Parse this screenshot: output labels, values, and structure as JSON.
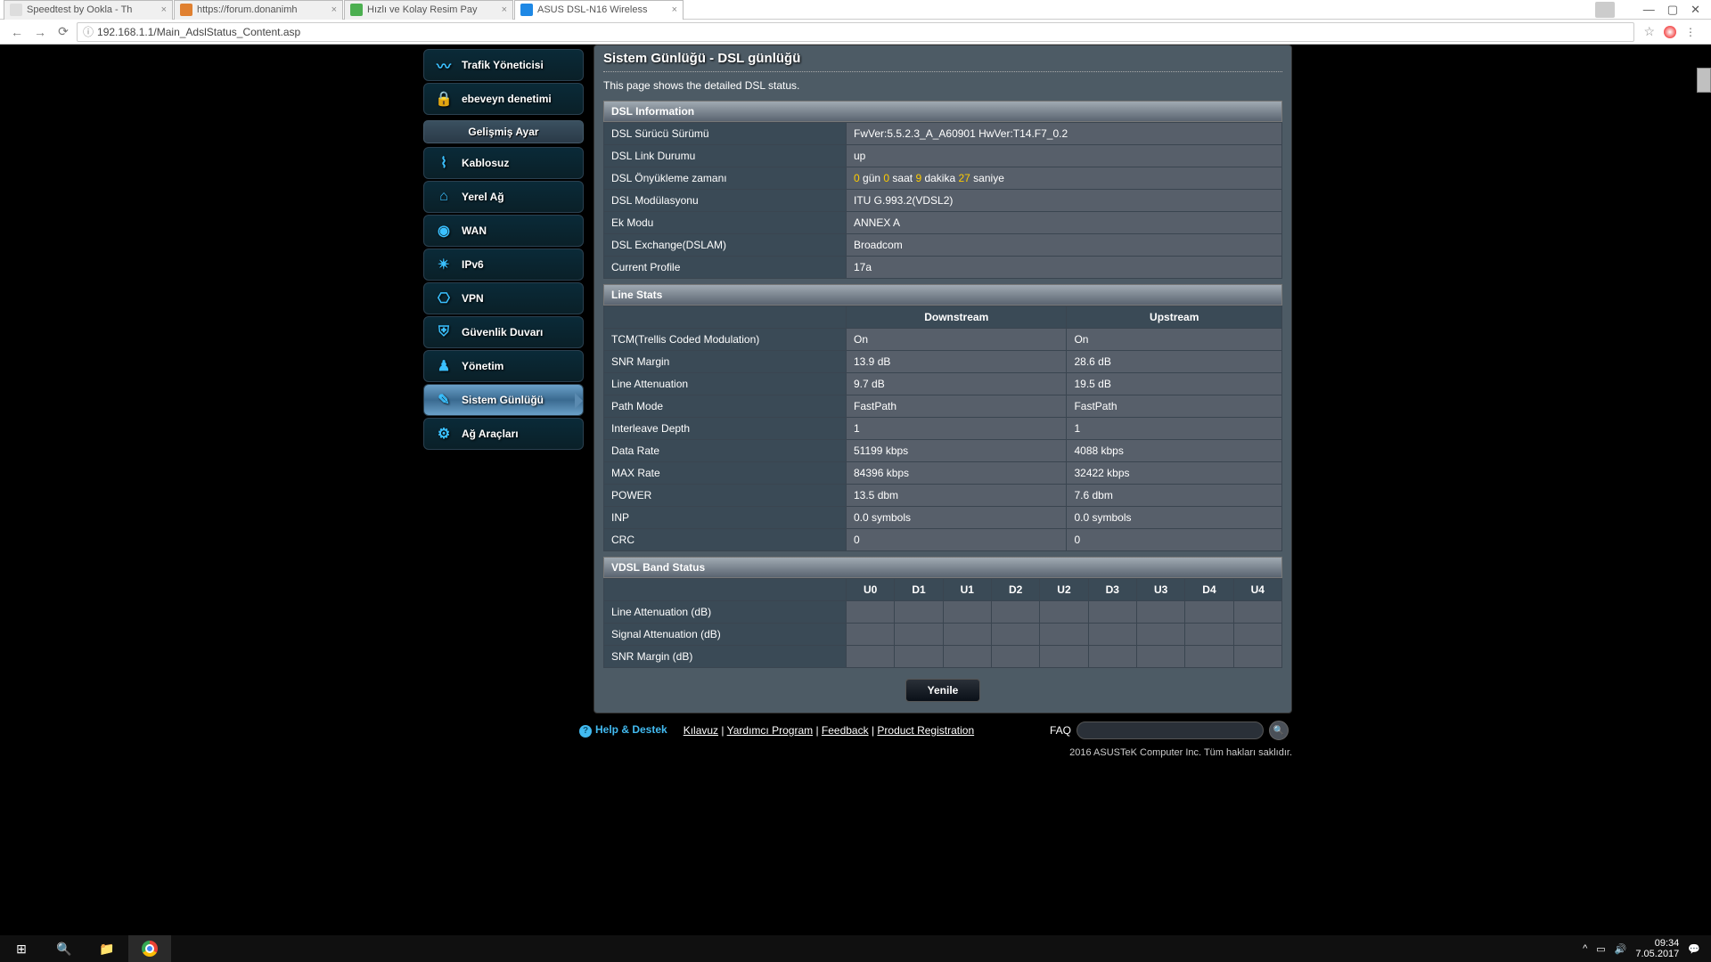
{
  "browser": {
    "tabs": [
      {
        "label": "Speedtest by Ookla - Th"
      },
      {
        "label": "https://forum.donanimh"
      },
      {
        "label": "Hızlı ve Kolay Resim Pay"
      },
      {
        "label": "ASUS DSL-N16 Wireless"
      }
    ],
    "url": "192.168.1.1/Main_AdslStatus_Content.asp"
  },
  "sidebar": {
    "items_top": [
      {
        "label": "Trafik Yöneticisi",
        "icon": "〰"
      },
      {
        "label": "ebeveyn denetimi",
        "icon": "🔒"
      }
    ],
    "section": "Gelişmiş Ayar",
    "items": [
      {
        "label": "Kablosuz",
        "icon": "⌇"
      },
      {
        "label": "Yerel Ağ",
        "icon": "⌂"
      },
      {
        "label": "WAN",
        "icon": "◉"
      },
      {
        "label": "IPv6",
        "icon": "✴"
      },
      {
        "label": "VPN",
        "icon": "⎔"
      },
      {
        "label": "Güvenlik Duvarı",
        "icon": "⛨"
      },
      {
        "label": "Yönetim",
        "icon": "♟"
      },
      {
        "label": "Sistem Günlüğü",
        "icon": "✎"
      },
      {
        "label": "Ağ Araçları",
        "icon": "⚙"
      }
    ],
    "active_index": 7
  },
  "page": {
    "title": "Sistem Günlüğü - DSL günlüğü",
    "desc": "This page shows the detailed DSL status.",
    "dsl_info_header": "DSL Information",
    "dsl_info": [
      {
        "label": "DSL Sürücü Sürümü",
        "value": "FwVer:5.5.2.3_A_A60901 HwVer:T14.F7_0.2"
      },
      {
        "label": "DSL Link Durumu",
        "value": "up"
      },
      {
        "label": "DSL Önyükleme zamanı",
        "value_parts": [
          "0",
          " gün ",
          "0",
          " saat ",
          "9",
          " dakika ",
          "27",
          " saniye"
        ]
      },
      {
        "label": "DSL Modülasyonu",
        "value": "ITU G.993.2(VDSL2)"
      },
      {
        "label": "Ek Modu",
        "value": "ANNEX A"
      },
      {
        "label": "DSL Exchange(DSLAM)",
        "value": "Broadcom"
      },
      {
        "label": "Current Profile",
        "value": "17a"
      }
    ],
    "line_stats_header": "Line Stats",
    "line_stats_cols": [
      "Downstream",
      "Upstream"
    ],
    "line_stats": [
      {
        "label": "TCM(Trellis Coded Modulation)",
        "down": "On",
        "up": "On"
      },
      {
        "label": "SNR Margin",
        "down": "13.9 dB",
        "up": "28.6 dB"
      },
      {
        "label": "Line Attenuation",
        "down": "9.7 dB",
        "up": "19.5 dB"
      },
      {
        "label": "Path Mode",
        "down": "FastPath",
        "up": "FastPath"
      },
      {
        "label": "Interleave Depth",
        "down": "1",
        "up": "1"
      },
      {
        "label": "Data Rate",
        "down": "51199 kbps",
        "up": "4088 kbps"
      },
      {
        "label": "MAX Rate",
        "down": "84396 kbps",
        "up": "32422 kbps"
      },
      {
        "label": "POWER",
        "down": "13.5 dbm",
        "up": "7.6 dbm"
      },
      {
        "label": "INP",
        "down": "0.0 symbols",
        "up": "0.0 symbols"
      },
      {
        "label": "CRC",
        "down": "0",
        "up": "0"
      }
    ],
    "vdsl_header": "VDSL Band Status",
    "vdsl_cols": [
      "U0",
      "D1",
      "U1",
      "D2",
      "U2",
      "D3",
      "U3",
      "D4",
      "U4"
    ],
    "vdsl_rows": [
      "Line Attenuation (dB)",
      "Signal Attenuation (dB)",
      "SNR Margin (dB)"
    ],
    "refresh": "Yenile"
  },
  "footer": {
    "help": "Help & Destek",
    "links": [
      "Kılavuz",
      "Yardımcı Program",
      "Feedback",
      "Product Registration"
    ],
    "faq": "FAQ",
    "copyright": "2016 ASUSTeK Computer Inc. Tüm hakları saklıdır."
  },
  "taskbar": {
    "time": "09:34",
    "date": "7.05.2017"
  }
}
